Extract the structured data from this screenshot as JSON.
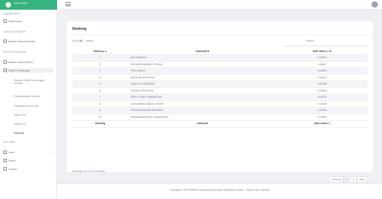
{
  "brand": {
    "name": "SPK BPNT"
  },
  "sidebar": {
    "headings": [
      "DASHBOARD",
      "DATA ALTERNATIF",
      "PROSES ANALISA",
      "SETTING"
    ],
    "items": [
      {
        "label": "Dashboard",
        "icon": "home-icon"
      },
      {
        "label": "Master Data Alternatif",
        "icon": "folder-icon"
      },
      {
        "label": "Master Data Kriteria",
        "icon": "chart-icon"
      },
      {
        "label": "Data Perhitungan",
        "icon": "calculator-icon"
      },
      {
        "label": "User",
        "icon": "user-icon"
      },
      {
        "label": "About",
        "icon": "info-icon"
      },
      {
        "label": "Logout",
        "icon": "logout-icon"
      }
    ],
    "subitems": [
      "Tambah Data Perhitungan Kriteria",
      "Perbandingan Kriteria",
      "Perbaikan Bobot (W)",
      "Vektor (S)",
      "Vektor (V)",
      "Ranking"
    ]
  },
  "card": {
    "title": "Ranking",
    "length_prefix": "Show",
    "length_value": "10",
    "length_suffix": "entries",
    "search_label": "Search:",
    "columns": [
      "Ranking",
      "Alternatif",
      "Nilai Vektor V"
    ],
    "rows": [
      [
        "1",
        "AGI HAMZAH",
        "0.06497"
      ],
      [
        "2",
        "DEONITA HAMIDA FITRIAH",
        "0.06447"
      ],
      [
        "3",
        "RINI HAMZA",
        "0.06445"
      ],
      [
        "4",
        "ANGGUN BATHIYUS",
        "0.06212"
      ],
      [
        "5",
        "WAGIS ALI SABRAN",
        "0.05758"
      ],
      [
        "6",
        "GENIKA PRASTIKA",
        "0.05400"
      ],
      [
        "7",
        "RUBY CASKY RAMADHAN",
        "0.05275"
      ],
      [
        "8",
        "MUHAMMAD ABDUL ROHIM",
        "0.04968"
      ],
      [
        "9",
        "PUTRA ARDIANA SAHARTA",
        "0.04950"
      ],
      [
        "10",
        "MUHAMMAD IRFAL RAMADHAN",
        "0.04836"
      ]
    ],
    "info": "Showing 1 to 10 of 20 entries",
    "pager": {
      "prev": "Previous",
      "p1": "1",
      "p2": "2",
      "next": "Next"
    }
  },
  "footer": {
    "text": "Copyright © 2023 Sistem Pendukung Keputusan Weighted Product - Sikb Al-Kairi | Jember"
  }
}
